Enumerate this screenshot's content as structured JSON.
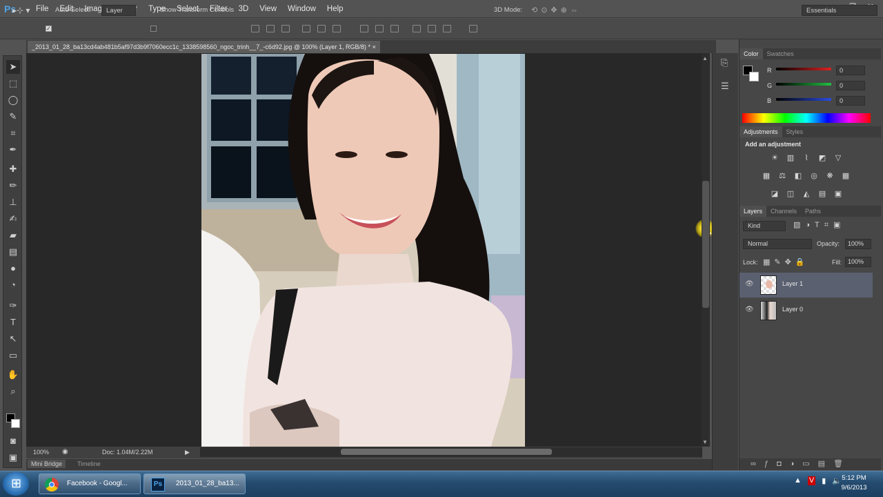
{
  "app": {
    "logo": "Ps"
  },
  "menu": [
    "File",
    "Edit",
    "Image",
    "Layer",
    "Type",
    "Select",
    "Filter",
    "3D",
    "View",
    "Window",
    "Help"
  ],
  "window_controls": [
    "–",
    "❐",
    "✕"
  ],
  "options_bar": {
    "auto_select_label": "Auto-Select:",
    "auto_select_target": "Layer",
    "transform_label": "Show Transform Controls",
    "mode_label": "3D Mode:",
    "workspace": "Essentials"
  },
  "document": {
    "tab_title": "_2013_01_28_ba13cd4ab481b5af97d3b9f7060ecc1c_1338598560_ngoc_trinh__7_-c6d92.jpg @ 100% (Layer 1, RGB/8) *",
    "zoom": "100%",
    "doc_info": "Doc: 1.04M/2.22M"
  },
  "bottom_tabs": {
    "mini_bridge": "Mini Bridge",
    "timeline": "Timeline"
  },
  "color_panel": {
    "tabs": [
      "Color",
      "Swatches"
    ],
    "r_label": "R",
    "g_label": "G",
    "b_label": "B",
    "r_value": "0",
    "g_value": "0",
    "b_value": "0",
    "colors": {
      "r": "#e02020",
      "g": "#20c040",
      "b": "#2a4be0"
    }
  },
  "adjustments_panel": {
    "tabs": [
      "Adjustments",
      "Styles"
    ],
    "heading": "Add an adjustment"
  },
  "layers_panel": {
    "tabs": [
      "Layers",
      "Channels",
      "Paths"
    ],
    "kind": "Kind",
    "blend_mode": "Normal",
    "opacity_label": "Opacity:",
    "opacity_value": "100%",
    "lock_label": "Lock:",
    "fill_label": "Fill:",
    "fill_value": "100%",
    "layers": [
      {
        "name": "Layer 1",
        "selected": true
      },
      {
        "name": "Layer 0",
        "selected": false
      }
    ]
  },
  "taskbar": {
    "chrome_label": "Facebook - Googl...",
    "ps_label": "2013_01_28_ba13...",
    "time": "5:12 PM",
    "date": "9/6/2013"
  }
}
